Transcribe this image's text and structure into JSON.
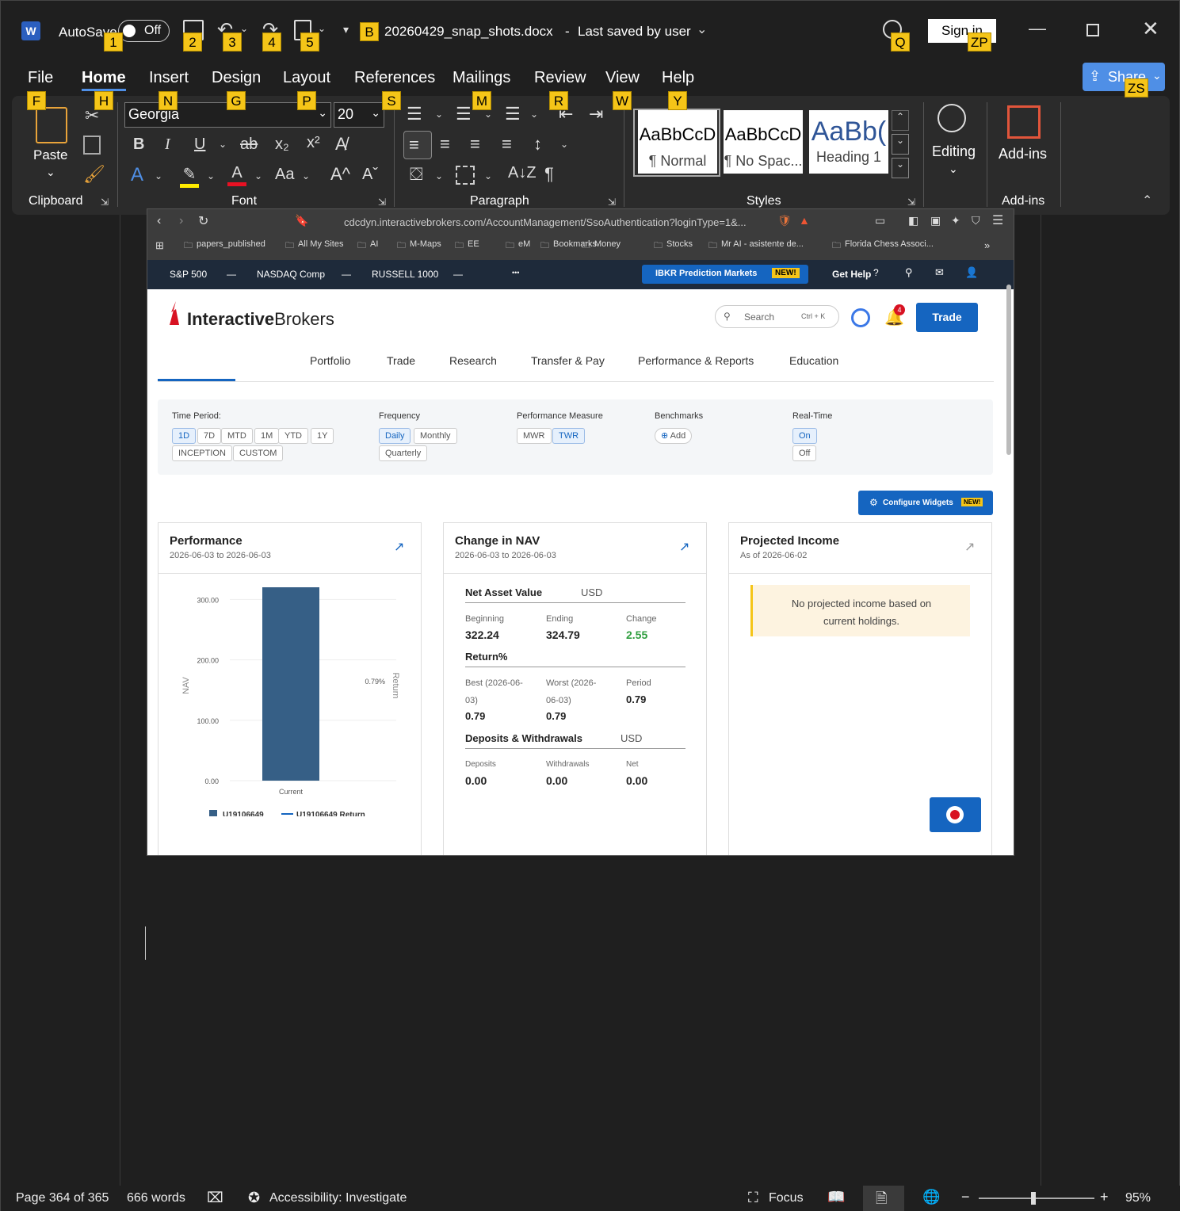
{
  "titlebar": {
    "autosave": "AutoSave",
    "toggle": "Off",
    "filename": "20260429_snap_shots.docx",
    "sep": "-",
    "saved": "Last saved by user",
    "signin": "Sign in"
  },
  "keytips": {
    "autosave": "1",
    "save": "2",
    "undo": "3",
    "redo": "4",
    "clip": "5",
    "custom": "B",
    "search": "Q",
    "signin": "ZP",
    "share": "ZS",
    "file": "F",
    "home": "H",
    "insert": "N",
    "design": "G",
    "layout": "P",
    "references": "S",
    "mailings": "M",
    "review": "R",
    "view": "W",
    "help": "Y"
  },
  "tabs": {
    "file": "File",
    "home": "Home",
    "insert": "Insert",
    "design": "Design",
    "layout": "Layout",
    "references": "References",
    "mailings": "Mailings",
    "review": "Review",
    "view": "View",
    "help": "Help",
    "share": "Share"
  },
  "ribbon": {
    "paste": "Paste",
    "clipboard": "Clipboard",
    "font_name": "Georgia",
    "font_size": "20",
    "font": "Font",
    "paragraph": "Paragraph",
    "styles": "Styles",
    "editing": "Editing",
    "addins": "Add-ins",
    "addins_group": "Add-ins",
    "style_cards": [
      {
        "preview": "AaBbCcD",
        "name": "¶ Normal"
      },
      {
        "preview": "AaBbCcD",
        "name": "¶ No Spac..."
      },
      {
        "preview": "AaBb(",
        "name": "Heading 1"
      }
    ]
  },
  "browser": {
    "url": "cdcdyn.interactivebrokers.com/AccountManagement/SsoAuthentication?loginType=1&...",
    "bookmarks": [
      "papers_published",
      "All My Sites",
      "AI",
      "M-Maps",
      "EE",
      "eM",
      "Bookmarks",
      "Money",
      "Stocks",
      "Mr AI - asistente de...",
      "Florida Chess Associ..."
    ]
  },
  "ticker": {
    "sp": "S&P 500",
    "dash1": "—",
    "nasdaq": "NASDAQ Comp",
    "dash2": "—",
    "russell": "RUSSELL 1000",
    "dash3": "—",
    "more": "•••",
    "promo": "IBKR Prediction Markets",
    "promo_badge": "NEW!",
    "help": "Get Help"
  },
  "ib": {
    "logo_a": "Interactive",
    "logo_b": "Brokers",
    "search": "Search",
    "search_kbd": "Ctrl + K",
    "bell_count": "4",
    "trade": "Trade",
    "nav": [
      "Portfolio",
      "Trade",
      "Research",
      "Transfer & Pay",
      "Performance & Reports",
      "Education"
    ]
  },
  "filters": {
    "time_label": "Time Period:",
    "time": [
      "1D",
      "7D",
      "MTD",
      "1M",
      "YTD",
      "1Y",
      "INCEPTION",
      "CUSTOM"
    ],
    "freq_label": "Frequency",
    "freq": [
      "Daily",
      "Monthly",
      "Quarterly"
    ],
    "measure_label": "Performance Measure",
    "measure": [
      "MWR",
      "TWR"
    ],
    "bench_label": "Benchmarks",
    "bench_add": "Add",
    "rt_label": "Real-Time",
    "rt": [
      "On",
      "Off"
    ],
    "configure": "Configure Widgets",
    "configure_badge": "NEW!"
  },
  "perf": {
    "title": "Performance",
    "sub": "2026-06-03 to 2026-06-03",
    "legend1": "U19106649",
    "legend2": "U19106649 Return"
  },
  "chart_data": {
    "type": "bar",
    "categories": [
      "Current"
    ],
    "series": [
      {
        "name": "U19106649",
        "values": [
          322.24
        ]
      },
      {
        "name": "U19106649 Return",
        "values": [
          0.79
        ]
      }
    ],
    "ylabel": "NAV",
    "y2label": "Return",
    "ylim": [
      0,
      300
    ],
    "yticks": [
      "0.00",
      "100.00",
      "200.00",
      "300.00"
    ],
    "y2tick": "0.79%",
    "grid": true,
    "legend": "bottom"
  },
  "nav": {
    "title": "Change in NAV",
    "sub": "2026-06-03 to 2026-06-03",
    "h1": "Net Asset Value",
    "cur1": "USD",
    "l_begin": "Beginning",
    "v_begin": "322.24",
    "l_end": "Ending",
    "v_end": "324.79",
    "l_change": "Change",
    "v_change": "2.55",
    "h2": "Return%",
    "l_best": "Best (2026-06-",
    "l_best2": "03)",
    "v_best": "0.79",
    "l_worst": "Worst (2026-",
    "l_worst2": "06-03)",
    "v_worst": "0.79",
    "l_period": "Period",
    "v_period": "0.79",
    "h3": "Deposits & Withdrawals",
    "cur3": "USD",
    "l_dep": "Deposits",
    "v_dep": "0.00",
    "l_wd": "Withdrawals",
    "v_wd": "0.00",
    "l_net": "Net",
    "v_net": "0.00"
  },
  "proj": {
    "title": "Projected Income",
    "sub": "As of 2026-06-02",
    "msg1": "No projected income based on",
    "msg2": "current holdings."
  },
  "status": {
    "page": "Page 364 of 365",
    "words": "666 words",
    "access": "Accessibility: Investigate",
    "focus": "Focus",
    "zoom": "95%"
  },
  "colors": {
    "accent": "#0d5bc6",
    "ib_red": "#d81222",
    "bar": "#365f86",
    "positive": "#2e9e3e",
    "keytip": "#f5c518",
    "share": "#4f8fe6"
  }
}
